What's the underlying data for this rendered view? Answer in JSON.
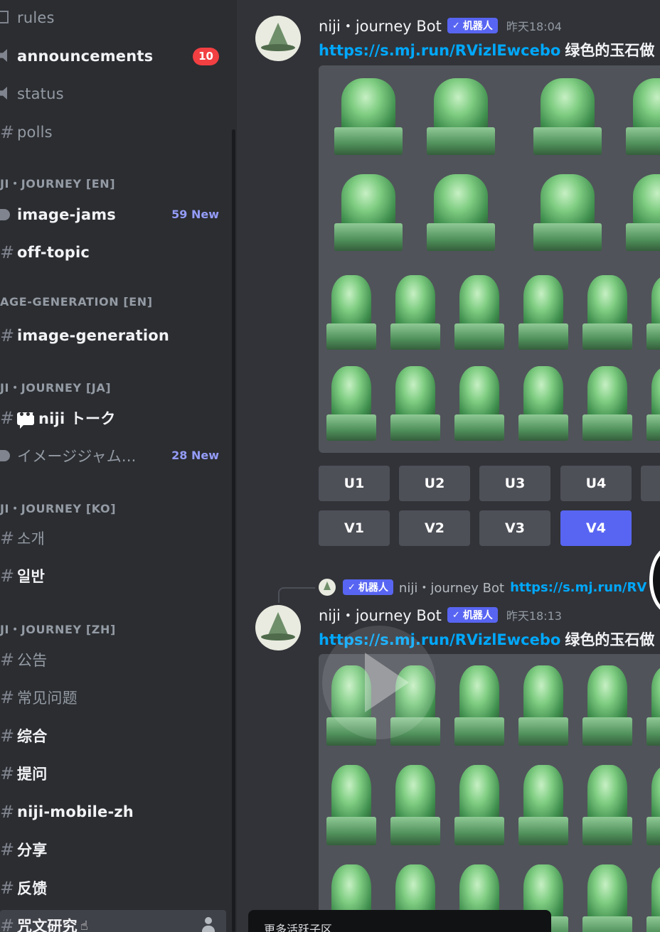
{
  "sidebar": {
    "channels": [
      {
        "id": "rules",
        "name": "rules",
        "icon": "rules-doc-icon",
        "style": "dim"
      },
      {
        "id": "announcements",
        "name": "announcements",
        "icon": "announcement-speaker-icon",
        "style": "bright",
        "badge": "10"
      },
      {
        "id": "status",
        "name": "status",
        "icon": "announcement-speaker-icon",
        "style": "dim"
      },
      {
        "id": "polls",
        "name": "polls",
        "icon": "hashtag-icon",
        "style": "dim"
      }
    ],
    "categories": [
      {
        "label": "JI・JOURNEY [EN]"
      },
      {
        "label": "AGE-GENERATION [EN]"
      },
      {
        "label": "JI・JOURNEY [JA]"
      },
      {
        "label": "JI・JOURNEY [KO]"
      },
      {
        "label": "JI・JOURNEY [ZH]"
      }
    ],
    "en_channels": [
      {
        "name": "image-jams",
        "new": "59 New"
      },
      {
        "name": "off-topic"
      }
    ],
    "gen_channels": [
      {
        "name": "image-generation"
      }
    ],
    "ja_channels": [
      {
        "name": "niji トーク"
      },
      {
        "name": "イメージジャム...",
        "new": "28 New"
      }
    ],
    "ko_channels": [
      {
        "name": "소개"
      },
      {
        "name": "일반"
      }
    ],
    "zh_channels": [
      {
        "name": "公告"
      },
      {
        "name": "常见问题"
      },
      {
        "name": "综合"
      },
      {
        "name": "提问"
      },
      {
        "name": "niji-mobile-zh"
      },
      {
        "name": "分享"
      },
      {
        "name": "反馈"
      },
      {
        "name": "咒文研究"
      }
    ]
  },
  "messages": [
    {
      "author": "niji・journey Bot",
      "bot_tag": "机器人",
      "timestamp": "昨天18:04",
      "link": "https://s.mj.run/RVizlEwcebo",
      "prompt": "绿色的玉石做"
    },
    {
      "author": "niji・journey Bot",
      "bot_tag": "机器人",
      "timestamp": "昨天18:13",
      "link": "https://s.mj.run/RVizlEwcebo",
      "prompt": "绿色的玉石做"
    }
  ],
  "reply": {
    "bot_tag": "机器人",
    "author": "niji・journey Bot",
    "link": "https://s.mj.run/RV"
  },
  "buttons": {
    "upscale": [
      "U1",
      "U2",
      "U3",
      "U4"
    ],
    "variation": [
      "V1",
      "V2",
      "V3",
      "V4"
    ],
    "active": "V4"
  },
  "tooltip": "更多活跃子区",
  "colors": {
    "accent": "#5865f2",
    "link": "#00a8fc",
    "badge": "#f23f42",
    "jade": "#7fcd82"
  }
}
